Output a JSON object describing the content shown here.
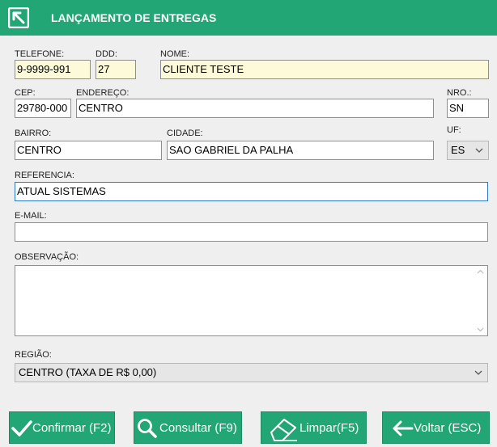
{
  "title": "LANÇAMENTO DE ENTREGAS",
  "fields": {
    "telefone": {
      "label": "TELEFONE:",
      "value": "9-9999-991"
    },
    "ddd": {
      "label": "DDD:",
      "value": "27"
    },
    "nome": {
      "label": "NOME:",
      "value": "CLIENTE TESTE"
    },
    "cep": {
      "label": "CEP:",
      "value": "29780-000"
    },
    "endereco": {
      "label": "ENDEREÇO:",
      "value": "CENTRO"
    },
    "nro": {
      "label": "NRO.:",
      "value": "SN"
    },
    "bairro": {
      "label": "BAIRRO:",
      "value": "CENTRO"
    },
    "cidade": {
      "label": "CIDADE:",
      "value": "SAO GABRIEL DA PALHA"
    },
    "uf": {
      "label": "UF:",
      "value": "ES"
    },
    "referencia": {
      "label": "REFERENCIA:",
      "value": "ATUAL SISTEMAS"
    },
    "email": {
      "label": "E-MAIL:",
      "value": ""
    },
    "observacao": {
      "label": "OBSERVAÇÃO:",
      "value": ""
    },
    "regiao": {
      "label": "REGIÃO:",
      "value": "CENTRO (TAXA DE R$ 0,00)"
    }
  },
  "buttons": {
    "confirmar": "Confirmar (F2)",
    "consultar": "Consultar (F9)",
    "limpar": "Limpar(F5)",
    "voltar": "Voltar (ESC)"
  },
  "colors": {
    "accent": "#23a676",
    "highlight_field": "#fcfad8",
    "focus_border": "#2f78c5"
  },
  "icons": {
    "app": "arrow-up-left-icon",
    "confirmar": "check-icon",
    "consultar": "search-icon",
    "limpar": "eraser-icon",
    "voltar": "arrow-left-icon"
  }
}
